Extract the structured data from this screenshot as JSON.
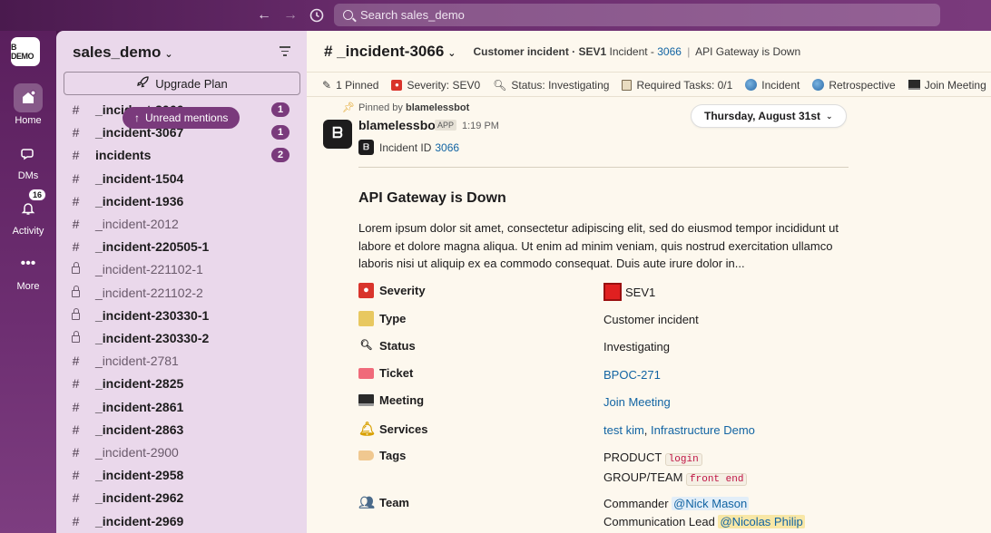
{
  "search": {
    "placeholder": "Search sales_demo"
  },
  "rail": {
    "logo_text": "B DEMO",
    "items": [
      {
        "label": "Home"
      },
      {
        "label": "DMs"
      },
      {
        "label": "Activity",
        "badge": "16"
      },
      {
        "label": "More"
      }
    ]
  },
  "sidebar": {
    "workspace": "sales_demo",
    "upgrade_label": "Upgrade Plan",
    "unread_label": "Unread mentions",
    "channels": [
      {
        "name": "_incident-3066",
        "prefix": "#",
        "bold": true,
        "count": "1"
      },
      {
        "name": "_incident-3067",
        "prefix": "#",
        "bold": true,
        "count": "1"
      },
      {
        "name": "incidents",
        "prefix": "#",
        "bold": true,
        "count": "2"
      },
      {
        "name": "_incident-1504",
        "prefix": "#",
        "bold": true
      },
      {
        "name": "_incident-1936",
        "prefix": "#",
        "bold": true
      },
      {
        "name": "_incident-2012",
        "prefix": "#",
        "bold": false
      },
      {
        "name": "_incident-220505-1",
        "prefix": "#",
        "bold": true
      },
      {
        "name": "_incident-221102-1",
        "prefix": "lock",
        "bold": false
      },
      {
        "name": "_incident-221102-2",
        "prefix": "lock",
        "bold": false
      },
      {
        "name": "_incident-230330-1",
        "prefix": "lock",
        "bold": true
      },
      {
        "name": "_incident-230330-2",
        "prefix": "lock",
        "bold": true
      },
      {
        "name": "_incident-2781",
        "prefix": "#",
        "bold": false
      },
      {
        "name": "_incident-2825",
        "prefix": "#",
        "bold": true
      },
      {
        "name": "_incident-2861",
        "prefix": "#",
        "bold": true
      },
      {
        "name": "_incident-2863",
        "prefix": "#",
        "bold": true
      },
      {
        "name": "_incident-2900",
        "prefix": "#",
        "bold": false
      },
      {
        "name": "_incident-2958",
        "prefix": "#",
        "bold": true
      },
      {
        "name": "_incident-2962",
        "prefix": "#",
        "bold": true
      },
      {
        "name": "_incident-2969",
        "prefix": "#",
        "bold": true
      }
    ]
  },
  "channel": {
    "title": "# _incident-3066",
    "topic_bold": "Customer incident · SEV1",
    "topic_text": "Incident -",
    "topic_link": "3066",
    "topic_sep": "|",
    "topic_tail": "API Gateway is Down"
  },
  "tabs": [
    {
      "icon": "pin-icon",
      "label": "1 Pinned"
    },
    {
      "icon": "siren-icon",
      "label": "Severity: SEV0"
    },
    {
      "icon": "magnifier-icon",
      "label": "Status: Investigating"
    },
    {
      "icon": "clipboard-icon",
      "label": "Required Tasks: 0/1"
    },
    {
      "icon": "globe-icon",
      "label": "Incident"
    },
    {
      "icon": "globe-icon",
      "label": "Retrospective"
    },
    {
      "icon": "laptop-icon",
      "label": "Join Meeting"
    }
  ],
  "message": {
    "pinned_prefix": "Pinned by",
    "pinned_by": "blamelessbot",
    "date_label": "Thursday, August 31st",
    "sender": "blamelessbot",
    "app_tag": "APP",
    "time": "1:19 PM",
    "incident_id_label": "Incident ID",
    "incident_id": "3066",
    "card_title": "API Gateway is Down",
    "description": "Lorem ipsum dolor sit amet, consectetur adipiscing elit, sed do eiusmod tempor incididunt ut labore et dolore magna aliqua. Ut enim ad minim veniam, quis nostrud exercitation ullamco laboris nisi ut aliquip ex ea commodo consequat. Duis aute irure dolor in...",
    "fields": {
      "severity": {
        "label": "Severity",
        "value": "SEV1"
      },
      "type": {
        "label": "Type",
        "value": "Customer incident"
      },
      "status": {
        "label": "Status",
        "value": "Investigating"
      },
      "ticket": {
        "label": "Ticket",
        "value": "BPOC-271"
      },
      "meeting": {
        "label": "Meeting",
        "value": "Join Meeting"
      },
      "services": {
        "label": "Services",
        "value1": "test kim",
        "sep": ", ",
        "value2": "Infrastructure Demo"
      },
      "tags": {
        "label": "Tags",
        "line1_label": "PRODUCT",
        "line1_code": "login",
        "line2_label": "GROUP/TEAM",
        "line2_code": "front end"
      },
      "team": {
        "label": "Team",
        "role1": "Commander",
        "person1": "@Nick Mason",
        "role2": "Communication Lead",
        "person2": "@Nicolas Philip"
      }
    }
  },
  "colors": {
    "rail": "#5a1f5d",
    "sidebar": "#ead8eb",
    "main": "#fdf8ee",
    "link": "#1264a3",
    "badge": "#7a3a7c"
  }
}
